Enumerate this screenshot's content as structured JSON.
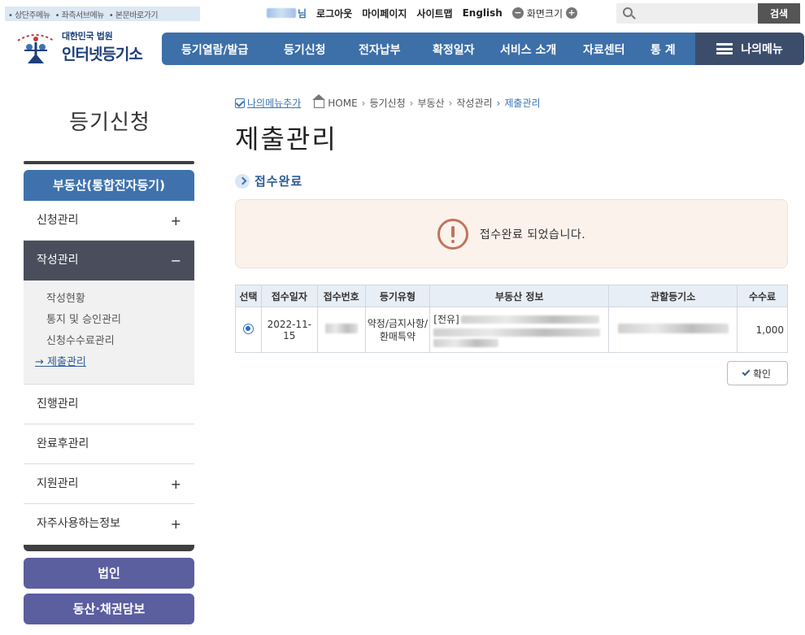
{
  "skip_links": [
    "• 상단주메뉴",
    "• 좌측서브메뉴",
    "• 본문바로가기"
  ],
  "util": {
    "user_suffix": "님",
    "logout": "로그아웃",
    "mypage": "마이페이지",
    "sitemap": "사이트맵",
    "english": "English",
    "screen_size": "화면크기"
  },
  "search": {
    "placeholder": "",
    "button": "검색"
  },
  "logo": {
    "small": "대한민국 법원",
    "big": "인터넷등기소"
  },
  "gnb": [
    "등기열람/발급",
    "등기신청",
    "전자납부",
    "확정일자",
    "서비스 소개",
    "자료센터",
    "통 계"
  ],
  "my_menu": "나의메뉴",
  "lnb": {
    "title": "등기신청",
    "head": "부동산(통합전자등기)",
    "items": [
      {
        "label": "신청관리",
        "pm": "+"
      },
      {
        "label": "작성관리",
        "pm": "−"
      },
      {
        "label": "진행관리",
        "pm": ""
      },
      {
        "label": "완료후관리",
        "pm": ""
      },
      {
        "label": "지원관리",
        "pm": "+"
      },
      {
        "label": "자주사용하는정보",
        "pm": "+"
      }
    ],
    "sub": [
      "작성현황",
      "통지 및 승인관리",
      "신청수수료관리",
      "→ 제출관리"
    ],
    "buttons": [
      "법인",
      "동산·채권담보"
    ]
  },
  "breadcrumb": {
    "add": "나의메뉴추가",
    "items": [
      "HOME",
      "등기신청",
      "부동산",
      "작성관리",
      "제출관리"
    ],
    "sep": "›"
  },
  "page_title": "제출관리",
  "section_title": "접수완료",
  "alert_msg": "접수완료 되었습니다.",
  "table": {
    "headers": [
      "선택",
      "접수일자",
      "접수번호",
      "등기유형",
      "부동산 정보",
      "관할등기소",
      "수수료"
    ],
    "row": {
      "date": "2022-11-15",
      "type": "약정/금지사항/환매특약",
      "property_prefix": "[전유]",
      "fee": "1,000"
    }
  },
  "confirm_button": "확인",
  "colors": {
    "gnb": "#3d6fa8",
    "my_menu": "#3b4d6b",
    "lnb_head": "#3f72ad",
    "lnb_active": "#4a4e5c",
    "lnb_btn": "#5b5e9f"
  }
}
